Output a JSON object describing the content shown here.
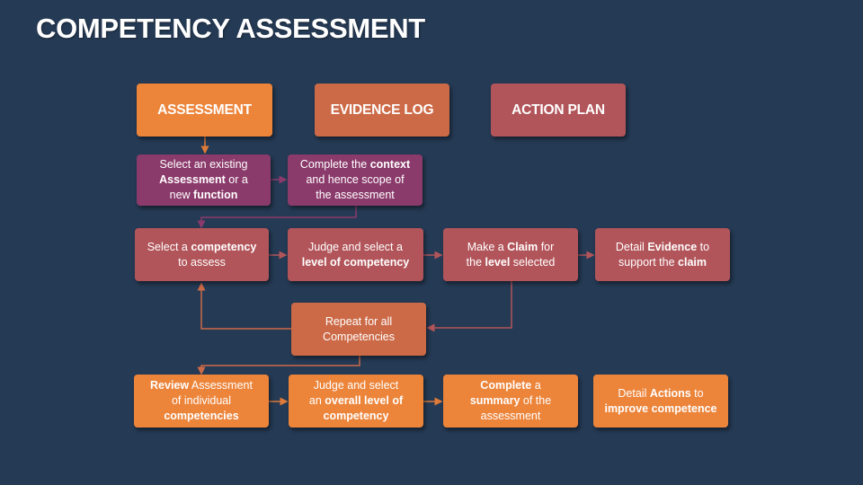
{
  "title": "COMPETENCY ASSESSMENT",
  "colors": {
    "background": "#253a54",
    "orange": "#ec843a",
    "rust": "#cc6a47",
    "rose": "#b2555a",
    "purple": "#8b3b6b",
    "text": "#ffffff"
  },
  "headers": [
    {
      "label": "ASSESSMENT"
    },
    {
      "label": "EVIDENCE LOG"
    },
    {
      "label": "ACTION PLAN"
    }
  ],
  "steps": {
    "select_assessment": [
      {
        "t": "Select an existing",
        "b": false
      },
      {
        "br": true
      },
      {
        "t": "Assessment",
        "b": true
      },
      {
        "t": " or a",
        "b": false
      },
      {
        "br": true
      },
      {
        "t": "new ",
        "b": false
      },
      {
        "t": "function",
        "b": true
      }
    ],
    "complete_context": [
      {
        "t": "Complete the ",
        "b": false
      },
      {
        "t": "context",
        "b": true
      },
      {
        "br": true
      },
      {
        "t": "and hence scope of",
        "b": false
      },
      {
        "br": true
      },
      {
        "t": "the assessment",
        "b": false
      }
    ],
    "select_competency": [
      {
        "t": "Select a ",
        "b": false
      },
      {
        "t": "competency",
        "b": true
      },
      {
        "br": true
      },
      {
        "t": "to assess",
        "b": false
      }
    ],
    "judge_level": [
      {
        "t": "Judge and select a",
        "b": false
      },
      {
        "br": true
      },
      {
        "t": "level of competency",
        "b": true
      }
    ],
    "make_claim": [
      {
        "t": "Make a ",
        "b": false
      },
      {
        "t": "Claim",
        "b": true
      },
      {
        "t": " for",
        "b": false
      },
      {
        "br": true
      },
      {
        "t": "the ",
        "b": false
      },
      {
        "t": "level",
        "b": true
      },
      {
        "t": " selected",
        "b": false
      }
    ],
    "detail_evidence": [
      {
        "t": "Detail ",
        "b": false
      },
      {
        "t": "Evidence",
        "b": true
      },
      {
        "t": " to",
        "b": false
      },
      {
        "br": true
      },
      {
        "t": "support the ",
        "b": false
      },
      {
        "t": "claim",
        "b": true
      }
    ],
    "repeat": [
      {
        "t": "Repeat for all",
        "b": false
      },
      {
        "br": true
      },
      {
        "t": "Competencies",
        "b": false
      }
    ],
    "review": [
      {
        "t": "Review",
        "b": true
      },
      {
        "t": " Assessment",
        "b": false
      },
      {
        "br": true
      },
      {
        "t": "of individual",
        "b": false
      },
      {
        "br": true
      },
      {
        "t": "competencies",
        "b": true
      }
    ],
    "judge_overall": [
      {
        "t": "Judge and select",
        "b": false
      },
      {
        "br": true
      },
      {
        "t": "an ",
        "b": false
      },
      {
        "t": "overall level of",
        "b": true
      },
      {
        "br": true
      },
      {
        "t": "competency",
        "b": true
      }
    ],
    "complete_summary": [
      {
        "t": "Complete",
        "b": true
      },
      {
        "t": " a",
        "b": false
      },
      {
        "br": true
      },
      {
        "t": "summary",
        "b": true
      },
      {
        "t": " of the",
        "b": false
      },
      {
        "br": true
      },
      {
        "t": "assessment",
        "b": false
      }
    ],
    "detail_actions": [
      {
        "t": "Detail ",
        "b": false
      },
      {
        "t": "Actions",
        "b": true
      },
      {
        "t": " to",
        "b": false
      },
      {
        "br": true
      },
      {
        "t": "improve competence",
        "b": true
      }
    ]
  },
  "connections": [
    {
      "from": "header-assessment",
      "to": "select-assessment"
    },
    {
      "from": "select-assessment",
      "to": "complete-context"
    },
    {
      "from": "complete-context",
      "to": "select-competency"
    },
    {
      "from": "select-competency",
      "to": "judge-level"
    },
    {
      "from": "judge-level",
      "to": "make-claim"
    },
    {
      "from": "make-claim",
      "to": "detail-evidence"
    },
    {
      "from": "make-claim",
      "to": "repeat"
    },
    {
      "from": "repeat",
      "to": "select-competency"
    },
    {
      "from": "repeat",
      "to": "review"
    },
    {
      "from": "review",
      "to": "judge-overall"
    },
    {
      "from": "judge-overall",
      "to": "complete-summary"
    }
  ]
}
